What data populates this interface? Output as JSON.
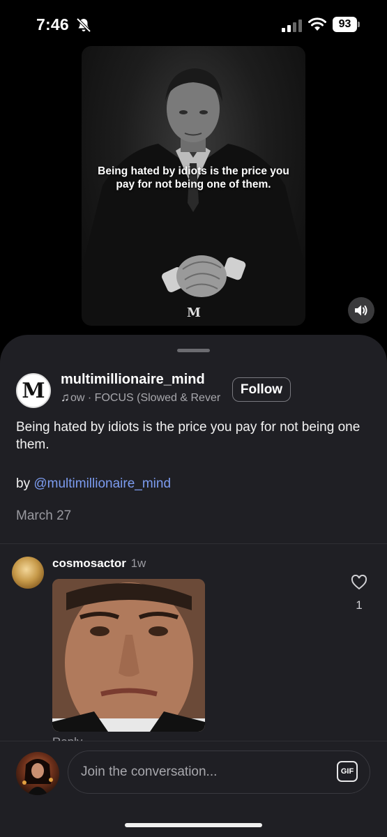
{
  "status_bar": {
    "time": "7:46",
    "battery": "93"
  },
  "video": {
    "overlay_text": "Being hated by idiots is the price you pay for not being one of them.",
    "logo": "M"
  },
  "post": {
    "author_avatar_letter": "M",
    "author": "multimillionaire_mind",
    "music": "ow · FOCUS (Slowed & Reverb)",
    "follow_label": "Follow",
    "caption": "Being hated by idiots is the price you pay for not being one them.",
    "byline_prefix": "by ",
    "byline_mention": "@multimillionaire_mind",
    "date": "March 27"
  },
  "comment": {
    "username": "cosmosactor",
    "age": "1w",
    "reply_label": "Reply",
    "like_count": "1"
  },
  "composer": {
    "placeholder": "Join the conversation...",
    "gif_label": "GIF"
  },
  "colors": {
    "sheet_background": "#1f1f24",
    "mention": "#7c9cf0"
  },
  "icons": [
    "bell-slash-icon",
    "signal-icon",
    "wifi-icon",
    "speaker-icon",
    "music-note-icon",
    "heart-icon",
    "gif-icon"
  ]
}
